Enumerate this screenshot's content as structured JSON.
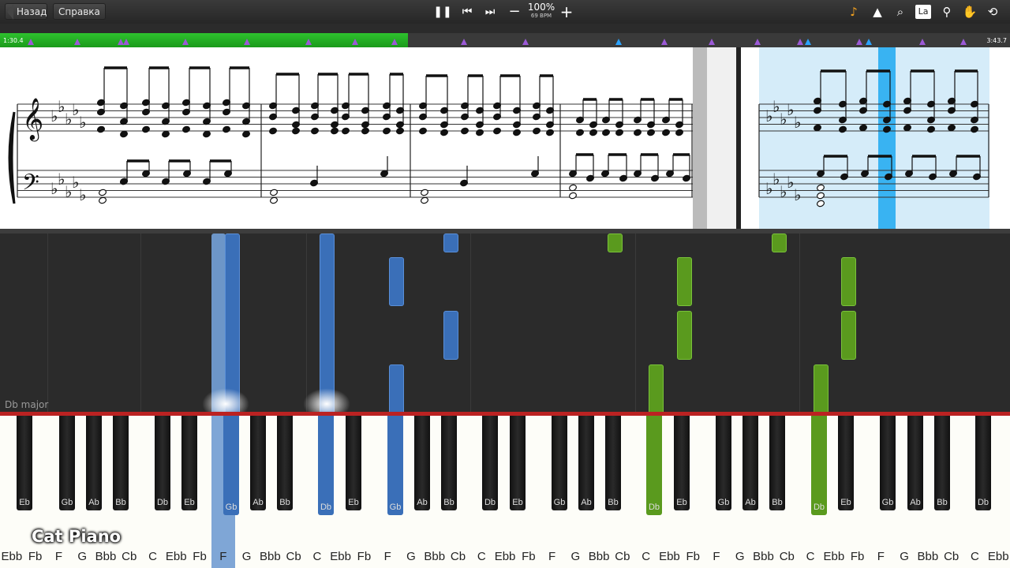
{
  "toolbar": {
    "back_label": "Назад",
    "help_label": "Справка",
    "pause_icon": "pause-icon",
    "prev_icon": "skip-back-icon",
    "next_icon": "skip-forward-icon",
    "zoom_out_icon": "minus-icon",
    "zoom_in_icon": "plus-icon",
    "zoom": "100%",
    "bpm": "69 BPM",
    "right_icons": [
      "note-icon",
      "metronome-icon",
      "search-icon",
      "la-icon",
      "pin-icon",
      "hand-icon",
      "loop-icon"
    ],
    "la_label": "La"
  },
  "progress": {
    "elapsed": "1:30.4",
    "total": "3:43.7",
    "fraction": 0.404
  },
  "roll": {
    "key_label": "Db major"
  },
  "keyboard": {
    "white_labels": [
      "Ebb",
      "Fb",
      "F",
      "G",
      "Bbb",
      "Cb",
      "C",
      "Ebb",
      "Fb",
      "F",
      "G",
      "Bbb",
      "Cb",
      "C",
      "Ebb",
      "Fb",
      "F",
      "G",
      "Bbb",
      "Cb",
      "C",
      "Ebb",
      "Fb",
      "F",
      "G",
      "Bbb",
      "Cb",
      "C",
      "Ebb",
      "Fb",
      "F",
      "G",
      "Bbb",
      "Cb",
      "C",
      "Ebb",
      "Fb",
      "F",
      "G",
      "Bbb",
      "Cb",
      "C",
      "Ebb"
    ],
    "black_labels": [
      "Eb",
      "Gb",
      "Ab",
      "Bb",
      "Db",
      "Eb",
      "Gb",
      "Ab",
      "Bb",
      "Db",
      "Eb",
      "Gb",
      "Ab",
      "Bb",
      "Db",
      "Eb",
      "Gb",
      "Ab",
      "Bb",
      "Db",
      "Eb",
      "Gb",
      "Ab",
      "Bb",
      "Db",
      "Eb",
      "Gb",
      "Ab",
      "Bb",
      "Db"
    ]
  },
  "watermark": "Cat Piano",
  "colors": {
    "right_hand": "#3a6fb8",
    "left_hand": "#5a9a1e",
    "progress": "#1fa81f",
    "cursor": "#39b3f2"
  }
}
